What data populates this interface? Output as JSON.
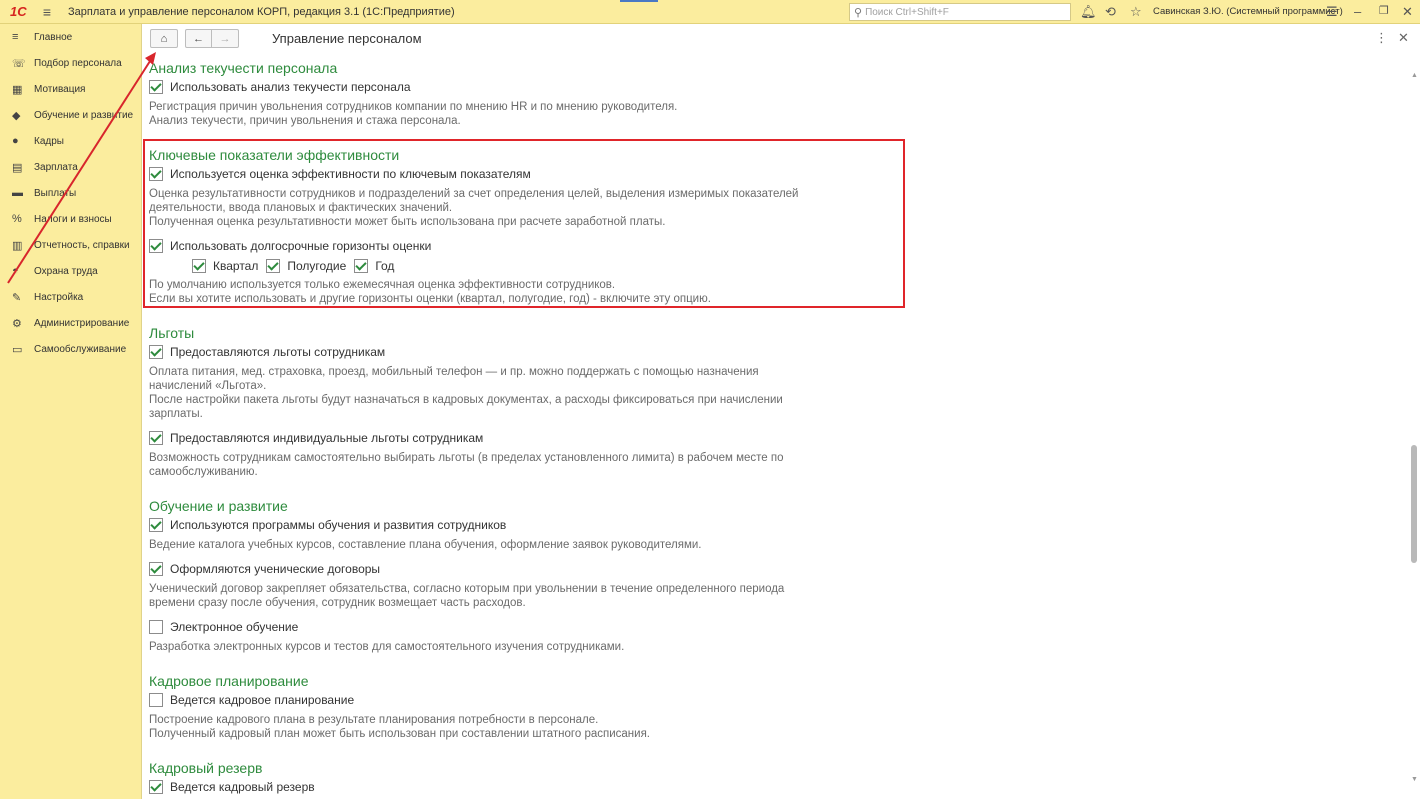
{
  "app": {
    "logo": "1С",
    "title": "Зарплата и управление персоналом КОРП, редакция 3.1  (1С:Предприятие)",
    "search_placeholder": "Поиск Ctrl+Shift+F",
    "user": "Савинская З.Ю. (Системный программист)"
  },
  "sidebar": {
    "items": [
      {
        "label": "Главное",
        "icon": "menu-icon"
      },
      {
        "label": "Подбор персонала",
        "icon": "recruit-icon"
      },
      {
        "label": "Мотивация",
        "icon": "gift-icon"
      },
      {
        "label": "Обучение и развитие",
        "icon": "graduation-cap-icon"
      },
      {
        "label": "Кадры",
        "icon": "people-icon"
      },
      {
        "label": "Зарплата",
        "icon": "calculator-icon"
      },
      {
        "label": "Выплаты",
        "icon": "wallet-icon"
      },
      {
        "label": "Налоги и взносы",
        "icon": "percent-icon"
      },
      {
        "label": "Отчетность, справки",
        "icon": "report-icon"
      },
      {
        "label": "Охрана труда",
        "icon": "helmet-icon"
      },
      {
        "label": "Настройка",
        "icon": "wrench-icon"
      },
      {
        "label": "Администрирование",
        "icon": "gear-icon"
      },
      {
        "label": "Самообслуживание",
        "icon": "id-card-icon"
      }
    ]
  },
  "toolbar": {
    "home": "⌂",
    "back": "←",
    "forward": "→",
    "page_title": "Управление персоналом"
  },
  "sections": {
    "turnover": {
      "title": "Анализ текучести персонала",
      "opt1": {
        "label": "Использовать анализ текучести персонала",
        "checked": true
      },
      "desc1": "Регистрация причин увольнения сотрудников компании по мнению HR и по мнению руководителя.",
      "desc2": "Анализ текучести, причин увольнения и стажа персонала."
    },
    "kpi": {
      "title": "Ключевые показатели эффективности",
      "opt1": {
        "label": "Используется оценка эффективности по ключевым показателям",
        "checked": true
      },
      "desc1": "Оценка результативности сотрудников и подразделений за счет определения целей,  выделения измеримых показателей",
      "desc2": "деятельности, ввода плановых и фактических значений.",
      "desc3": "Полученная оценка результативности может быть использована при расчете заработной платы.",
      "opt2": {
        "label": "Использовать долгосрочные горизонты оценки",
        "checked": true
      },
      "horizons": {
        "quarter": "Квартал",
        "halfyear": "Полугодие",
        "year": "Год"
      },
      "desc4": "По умолчанию используется только ежемесячная оценка эффективности сотрудников.",
      "desc5": "Если вы хотите использовать и другие горизонты оценки (квартал, полугодие, год) - включите эту опцию."
    },
    "benefits": {
      "title": "Льготы",
      "opt1": {
        "label": "Предоставляются льготы сотрудникам",
        "checked": true
      },
      "desc1": "Оплата питания, мед. страховка, проезд, мобильный телефон — и пр. можно поддержать с помощью назначения",
      "desc2": "начислений «Льгота».",
      "desc3": "После настройки пакета льготы будут назначаться в кадровых документах, а расходы фиксироваться при начислении",
      "desc4": "зарплаты.",
      "opt2": {
        "label": "Предоставляются индивидуальные льготы сотрудникам",
        "checked": true
      },
      "desc5": "Возможность сотрудникам самостоятельно выбирать льготы (в пределах  установленного лимита) в рабочем месте по",
      "desc6": "самообслуживанию."
    },
    "training": {
      "title": "Обучение и развитие",
      "opt1": {
        "label": "Используются программы обучения и развития сотрудников",
        "checked": true
      },
      "desc1": "Ведение каталога учебных курсов, составление плана обучения, оформление заявок руководителями.",
      "opt2": {
        "label": "Оформляются ученические договоры",
        "checked": true
      },
      "desc2": "Ученический договор закрепляет обязательства, согласно которым при увольнении в течение определенного периода",
      "desc3": "времени сразу после обучения, сотрудник возмещает часть расходов.",
      "opt3": {
        "label": "Электронное обучение",
        "checked": false
      },
      "desc4": "Разработка электронных курсов и тестов для самостоятельного изучения сотрудниками."
    },
    "planning": {
      "title": "Кадровое планирование",
      "opt1": {
        "label": "Ведется кадровое планирование",
        "checked": false
      },
      "desc1": "Построение кадрового плана в результате планирования потребности в персонале.",
      "desc2": "Полученный кадровый план может быть использован при составлении штатного расписания."
    },
    "reserve": {
      "title": "Кадровый резерв",
      "opt1": {
        "label": "Ведется кадровый резерв",
        "checked": true
      }
    }
  },
  "colors": {
    "accent_green": "#2e8b3d",
    "highlight_red": "#e0252a",
    "panel_yellow": "#fbed9e"
  }
}
